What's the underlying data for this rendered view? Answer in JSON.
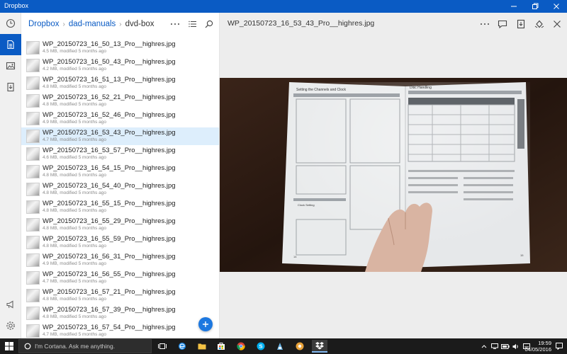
{
  "window": {
    "title": "Dropbox",
    "accent": "#0a5bc4"
  },
  "rail": {
    "items": [
      {
        "name": "recent-icon"
      },
      {
        "name": "files-icon",
        "active": true
      },
      {
        "name": "photos-icon"
      },
      {
        "name": "offline-icon"
      }
    ],
    "bottom": [
      {
        "name": "notifications-icon"
      },
      {
        "name": "settings-icon"
      }
    ]
  },
  "breadcrumb": {
    "root": "Dropbox",
    "parent": "dad-manuals",
    "current": "dvd-box"
  },
  "list_tools": [
    "more-icon",
    "sort-icon",
    "search-icon"
  ],
  "files": [
    {
      "name": "WP_20150723_16_50_13_Pro__highres.jpg",
      "meta": "4.5 MB, modified 5 months ago"
    },
    {
      "name": "WP_20150723_16_50_43_Pro__highres.jpg",
      "meta": "4.2 MB, modified 5 months ago"
    },
    {
      "name": "WP_20150723_16_51_13_Pro__highres.jpg",
      "meta": "4.8 MB, modified 5 months ago"
    },
    {
      "name": "WP_20150723_16_52_21_Pro__highres.jpg",
      "meta": "4.8 MB, modified 5 months ago"
    },
    {
      "name": "WP_20150723_16_52_46_Pro__highres.jpg",
      "meta": "4.9 MB, modified 5 months ago"
    },
    {
      "name": "WP_20150723_16_53_43_Pro__highres.jpg",
      "meta": "4.7 MB, modified 5 months ago",
      "selected": true
    },
    {
      "name": "WP_20150723_16_53_57_Pro__highres.jpg",
      "meta": "4.6 MB, modified 5 months ago"
    },
    {
      "name": "WP_20150723_16_54_15_Pro__highres.jpg",
      "meta": "4.8 MB, modified 5 months ago"
    },
    {
      "name": "WP_20150723_16_54_40_Pro__highres.jpg",
      "meta": "4.8 MB, modified 5 months ago"
    },
    {
      "name": "WP_20150723_16_55_15_Pro__highres.jpg",
      "meta": "4.8 MB, modified 5 months ago"
    },
    {
      "name": "WP_20150723_16_55_29_Pro__highres.jpg",
      "meta": "4.8 MB, modified 5 months ago"
    },
    {
      "name": "WP_20150723_16_55_59_Pro__highres.jpg",
      "meta": "4.8 MB, modified 5 months ago"
    },
    {
      "name": "WP_20150723_16_56_31_Pro__highres.jpg",
      "meta": "4.9 MB, modified 5 months ago"
    },
    {
      "name": "WP_20150723_16_56_55_Pro__highres.jpg",
      "meta": "4.7 MB, modified 5 months ago"
    },
    {
      "name": "WP_20150723_16_57_21_Pro__highres.jpg",
      "meta": "4.8 MB, modified 5 months ago"
    },
    {
      "name": "WP_20150723_16_57_39_Pro__highres.jpg",
      "meta": "4.8 MB, modified 5 months ago"
    },
    {
      "name": "WP_20150723_16_57_54_Pro__highres.jpg",
      "meta": "4.7 MB, modified 5 months ago"
    }
  ],
  "preview": {
    "title": "WP_20150723_16_53_43_Pro__highres.jpg",
    "tools": [
      "more-icon",
      "comment-icon",
      "export-icon",
      "share-icon",
      "close-icon"
    ],
    "manual_left_heading": "Setting the Channels and Clock",
    "manual_right_heading": "Disc Handling",
    "manual_section_heading": "Clock Setting",
    "manual_page_left": "14",
    "manual_page_right": "15"
  },
  "taskbar": {
    "search_placeholder": "I'm Cortana. Ask me anything.",
    "time": "19:59",
    "date": "04/05/2016"
  }
}
